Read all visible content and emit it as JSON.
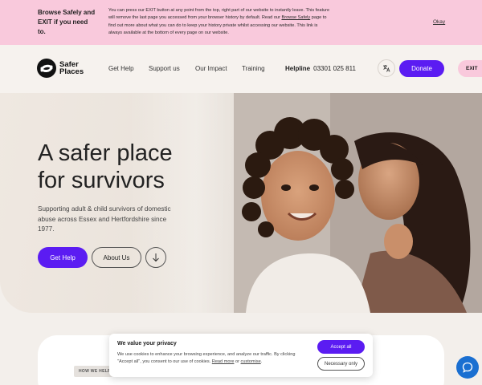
{
  "notice": {
    "title": "Browse Safely and EXIT if you need to.",
    "text_1": "You can press our EXIT button at any point from the top, right part of our website to instantly leave. This feature will remove the last page you accessed from your browser history by default. Read our ",
    "link": "Browse Safely",
    "text_2": " page to find out more about what you can do to keep your history private whilst accessing our website. This link is always available at the bottom of every page on our website.",
    "okay_label": "Okay"
  },
  "header": {
    "logo_text": "Safer Places",
    "nav": [
      "Get Help",
      "Support us",
      "Our Impact",
      "Training"
    ],
    "helpline_label": "Helpline",
    "helpline_number": "03301 025 811",
    "donate_label": "Donate",
    "exit_label": "EXIT"
  },
  "hero": {
    "title_line1": "A safer place",
    "title_line2": "for survivors",
    "subtitle": "Supporting adult & child survivors of domestic abuse across Essex and Hertfordshire since 1977.",
    "get_help_label": "Get Help",
    "about_label": "About Us"
  },
  "section": {
    "tag": "HOW WE HELP"
  },
  "cookie": {
    "title": "We value your privacy",
    "text_1": "We use cookies to enhance your browsing experience, and analyze our traffic. By clicking \"Accept all\", you consent to our use of cookies. ",
    "read_more": "Read more",
    "text_2": " or ",
    "customise": "customise",
    "text_3": ".",
    "accept_label": "Accept all",
    "necessary_label": "Necessary only"
  },
  "colors": {
    "brand_purple": "#5b1cf2",
    "notice_pink": "#f9c9dc",
    "page_bg": "#f3efeb",
    "chat_blue": "#1a6fd1"
  },
  "icons": [
    "logo-mark",
    "translate-icon",
    "arrow-down-icon",
    "chat-icon"
  ]
}
